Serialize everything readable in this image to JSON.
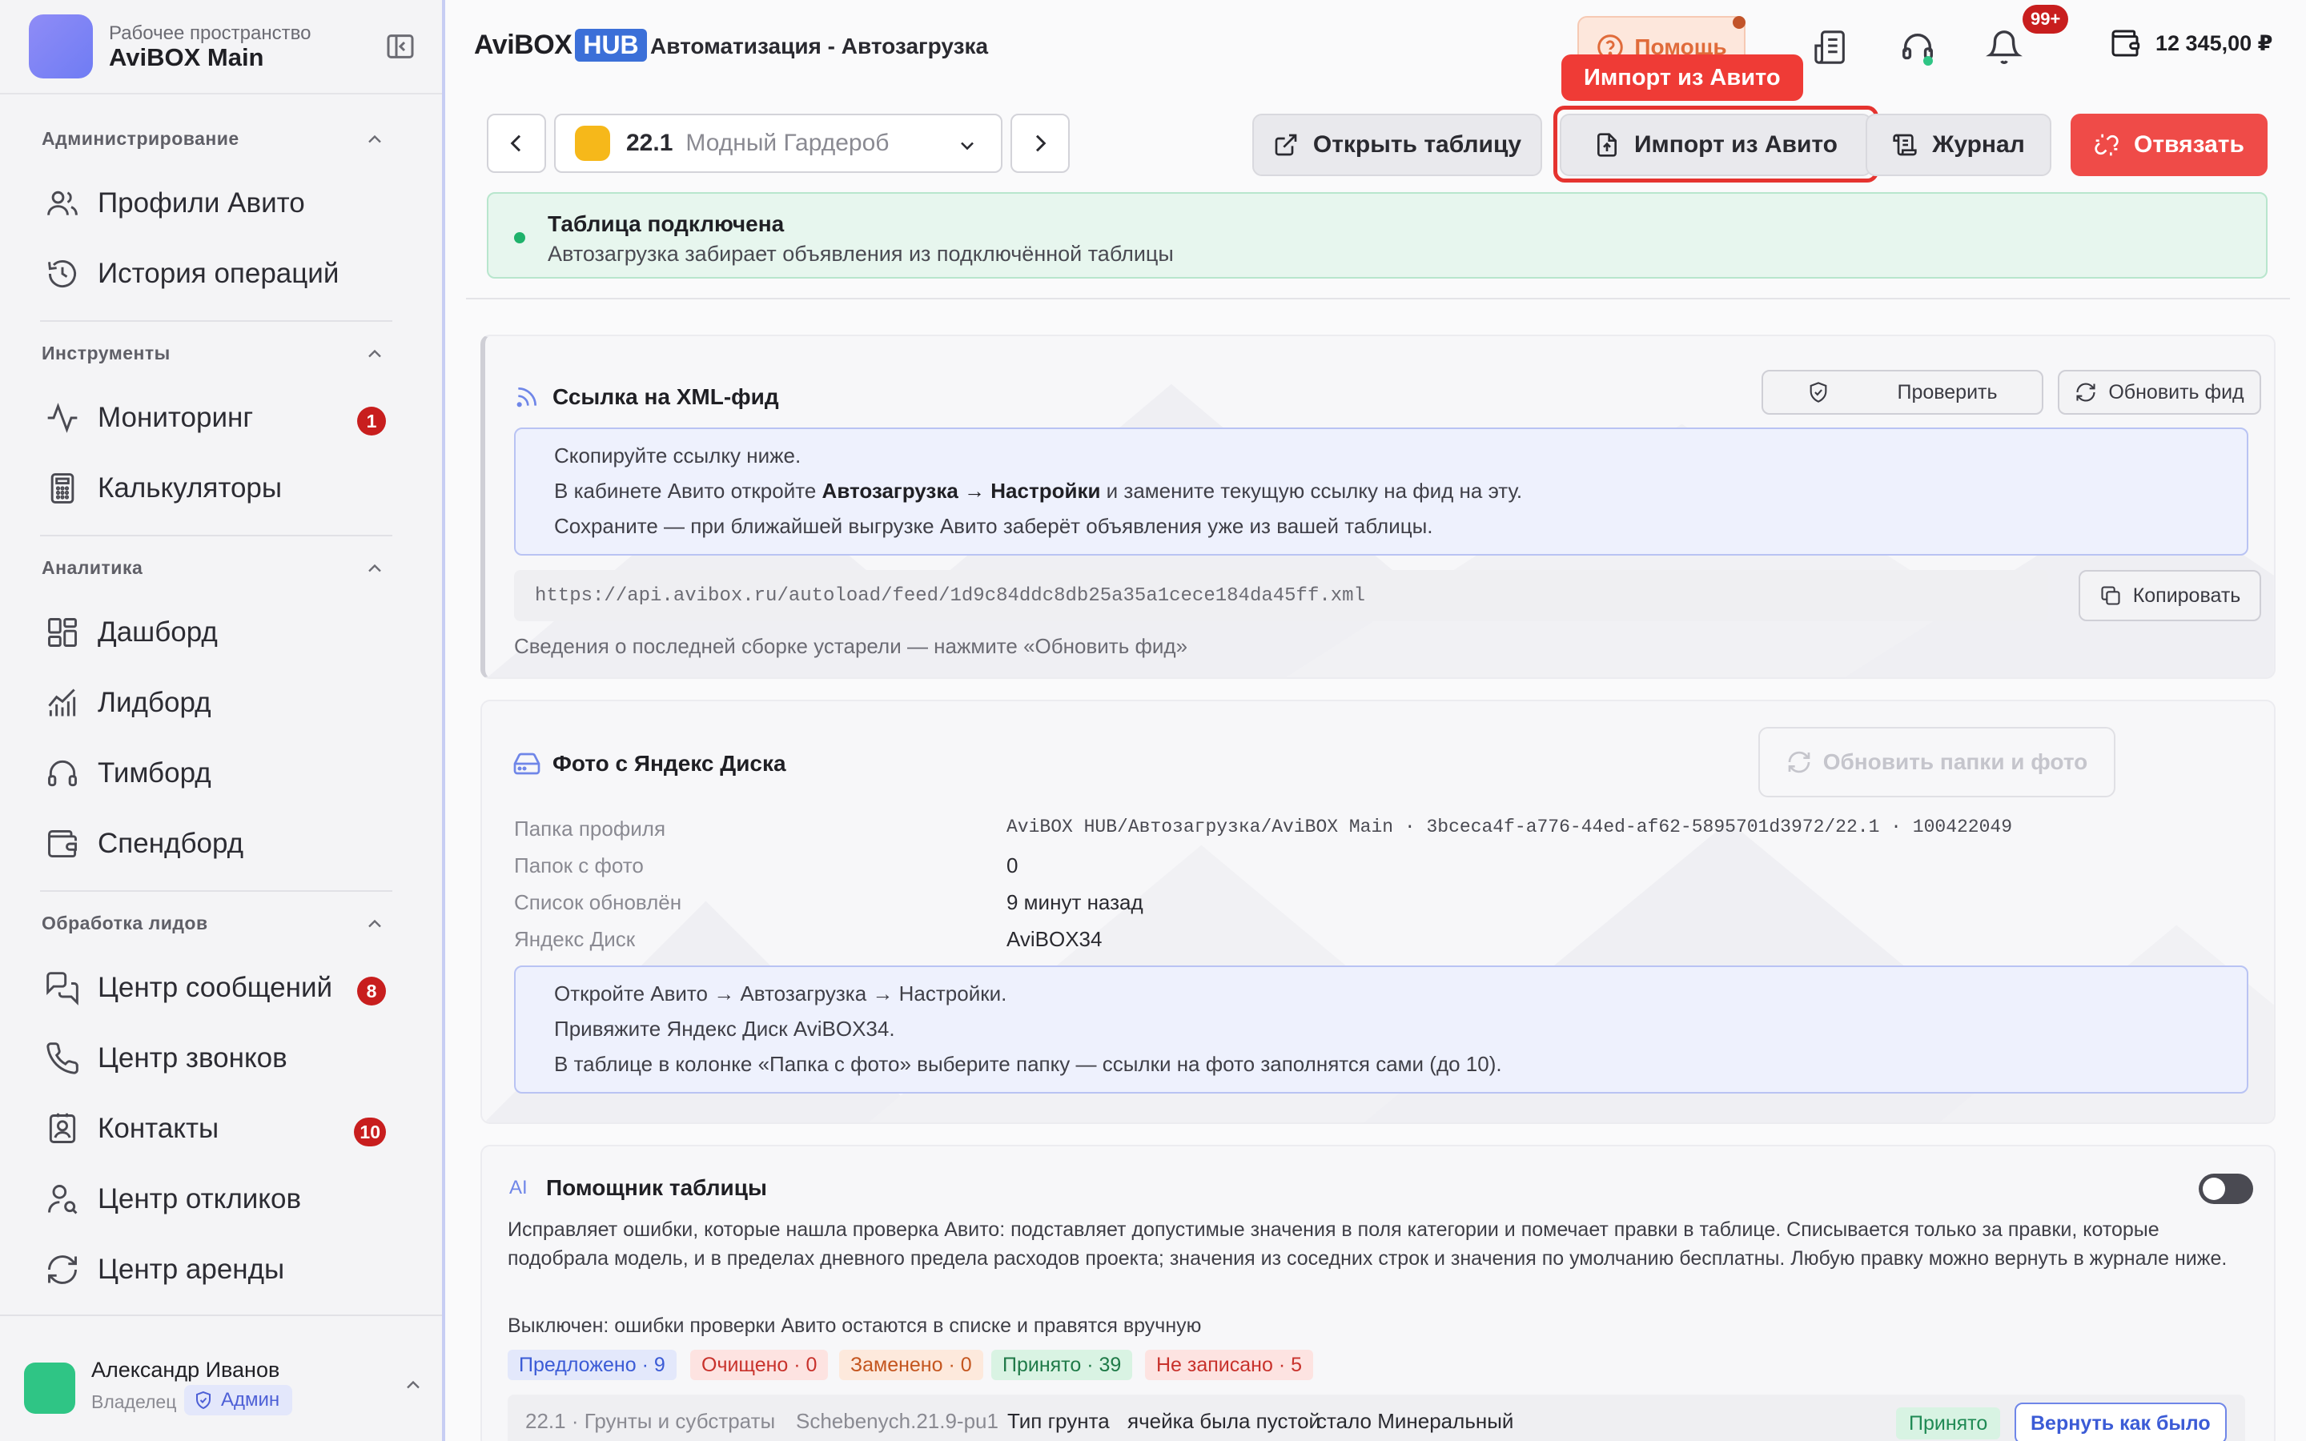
{
  "sidebar": {
    "workspace_sub": "Рабочее пространство",
    "workspace_title": "AviBOX Main",
    "sections": [
      {
        "title": "Администрирование",
        "items": [
          {
            "label": "Профили Авито",
            "icon": "users-icon"
          },
          {
            "label": "История операций",
            "icon": "history-icon"
          }
        ]
      },
      {
        "title": "Инструменты",
        "items": [
          {
            "label": "Мониторинг",
            "icon": "activity-icon",
            "badge": "1"
          },
          {
            "label": "Калькуляторы",
            "icon": "calculator-icon"
          }
        ]
      },
      {
        "title": "Аналитика",
        "items": [
          {
            "label": "Дашборд",
            "icon": "dashboard-icon"
          },
          {
            "label": "Лидборд",
            "icon": "chart-icon"
          },
          {
            "label": "Тимборд",
            "icon": "headset-icon"
          },
          {
            "label": "Спендборд",
            "icon": "wallet-icon"
          }
        ]
      },
      {
        "title": "Обработка лидов",
        "items": [
          {
            "label": "Центр сообщений",
            "icon": "messages-icon",
            "badge": "8"
          },
          {
            "label": "Центр звонков",
            "icon": "phone-icon"
          },
          {
            "label": "Контакты",
            "icon": "contacts-icon",
            "badge": "10"
          },
          {
            "label": "Центр откликов",
            "icon": "user-search-icon"
          },
          {
            "label": "Центр аренды",
            "icon": "refresh-icon"
          }
        ]
      }
    ],
    "user": {
      "name": "Александр Иванов",
      "role": "Владелец",
      "badge": "Админ"
    }
  },
  "topbar": {
    "brand_avi": "AviBOX",
    "brand_hub": "HUB",
    "title": "Автоматизация - Автозагрузка",
    "help_label": "Помощь",
    "notif_count": "99+",
    "balance": "12 345,00 ₽"
  },
  "toolbar": {
    "project_num": "22.1",
    "project_name": "Модный Гардероб",
    "open_table": "Открыть таблицу",
    "import_avito": "Импорт из Авито",
    "journal": "Журнал",
    "unlink": "Отвязать",
    "tooltip": "Импорт из Авито"
  },
  "status": {
    "title": "Таблица подключена",
    "text": "Автозагрузка забирает объявления из подключённой таблицы"
  },
  "xml_card": {
    "title": "Ссылка на XML-фид",
    "check_label": "Проверить",
    "refresh_label": "Обновить фид",
    "info_1": "Скопируйте ссылку ниже.",
    "info_2_pre": "В кабинете Авито откройте ",
    "info_2_bold": "Автозагрузка → Настройки",
    "info_2_post": " и замените текущую ссылку на фид на эту.",
    "info_3": "Сохраните — при ближайшей выгрузке Авито заберёт объявления уже из вашей таблицы.",
    "url": "https://api.avibox.ru/autoload/feed/1d9c84ddc8db25a35a1cece184da45ff.xml",
    "copy_label": "Копировать",
    "hint": "Сведения о последней сборке устарели — нажмите «Обновить фид»"
  },
  "yadisk_card": {
    "title": "Фото с Яндекс Диска",
    "refresh_label": "Обновить папки и фото",
    "rows": [
      {
        "key": "Папка профиля",
        "value": "AviBOX HUB/Автозагрузка/AviBOX Main · 3bceca4f-a776-44ed-af62-5895701d3972/22.1 · 100422049"
      },
      {
        "key": "Папок с фото",
        "value": "0"
      },
      {
        "key": "Список обновлён",
        "value": "9 минут назад"
      },
      {
        "key": "Яндекс Диск",
        "value": "AviBOX34"
      }
    ],
    "info_1": "Откройте Авито → Автозагрузка → Настройки.",
    "info_2": "Привяжите Яндекс Диск AviBOX34.",
    "info_3": "В таблице в колонке «Папка с фото» выберите папку — ссылки на фото заполнятся сами (до 10)."
  },
  "assistant_card": {
    "ai_tag": "AI",
    "title": "Помощник таблицы",
    "para_1": "Исправляет ошибки, которые нашла проверка Авито: подставляет допустимые значения в поля категории и помечает правки в таблице. Списывается только за правки, которые подобрала модель, и в пределах дневного предела расходов проекта; значения из соседних строк и значения по умолчанию бесплатны. Любую правку можно вернуть в журнале ниже.",
    "para_2": "Выключен: ошибки проверки Авито остаются в списке и правятся вручную",
    "chips": [
      {
        "label": "Предложено · 9",
        "bg": "#e3e8fb",
        "fg": "#3b5bd6"
      },
      {
        "label": "Очищено · 0",
        "bg": "#fde3e1",
        "fg": "#c8322c"
      },
      {
        "label": "Заменено · 0",
        "bg": "#fde9dc",
        "fg": "#c4561f"
      },
      {
        "label": "Принято · 39",
        "bg": "#d9f3e3",
        "fg": "#1f7a48"
      },
      {
        "label": "Не записано · 5",
        "bg": "#fde3e1",
        "fg": "#c8322c"
      }
    ],
    "row": {
      "project": "22.1 · Грунты и субстраты",
      "sku": "Schebenych.21.9-pu1",
      "field": "Тип грунта",
      "before": "ячейка была пустой",
      "after": "стало Минеральный",
      "status": "Принято",
      "revert": "Вернуть как было"
    }
  },
  "colors": {
    "accent": "#3b6fd8",
    "danger": "#ef4b48",
    "success": "#1fb26b"
  }
}
